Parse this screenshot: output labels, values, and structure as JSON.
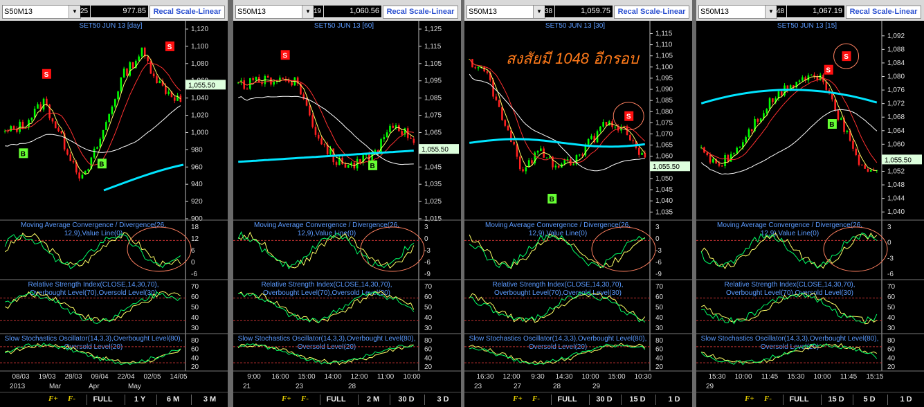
{
  "panels": [
    {
      "symbol": "S50M13",
      "count": "25",
      "price": "977.85",
      "recal": "Recal Scale-Linear",
      "chart_title": "SET50 JUN 13",
      "interval": "[day]",
      "price_label": "1,055.50",
      "yticks": [
        "1,120",
        "1,100",
        "1,080",
        "1,060",
        "1,040",
        "1,020",
        "1,000",
        "980",
        "960",
        "940",
        "920",
        "900"
      ],
      "ymin": 900,
      "ymax": 1120,
      "current_value": 1055.5,
      "xlabels": [
        "08/03",
        "19/03",
        "28/03",
        "09/04",
        "22/04",
        "02/05",
        "14/05"
      ],
      "xlabels2": [
        "2013",
        "Mar",
        "Apr",
        "May"
      ],
      "signals": [
        {
          "t": "S",
          "x": 0.24,
          "yv": 1068
        },
        {
          "t": "S",
          "x": 0.93,
          "yv": 1100
        },
        {
          "t": "B",
          "x": 0.11,
          "yv": 976
        },
        {
          "t": "B",
          "x": 0.55,
          "yv": 964
        }
      ],
      "macd_ticks": [
        "18",
        "12",
        "6",
        "0",
        "-6"
      ],
      "buttons": [
        "FULL",
        "1 Y",
        "6 M",
        "3 M"
      ],
      "circle_macd": true,
      "annotation": ""
    },
    {
      "symbol": "S50M13",
      "count": "19",
      "price": "1,060.56",
      "recal": "Recal Scale-Linear",
      "chart_title": "SET50 JUN 13",
      "interval": "[60]",
      "price_label": "1,055.50",
      "yticks": [
        "1,125",
        "1,115",
        "1,105",
        "1,095",
        "1,085",
        "1,075",
        "1,065",
        "1,055",
        "1,045",
        "1,035",
        "1,025",
        "1,015"
      ],
      "ymin": 1015,
      "ymax": 1125,
      "current_value": 1055.5,
      "xlabels": [
        "9:00",
        "16:00",
        "15:00",
        "14:00",
        "12:00",
        "11:00",
        "10:00"
      ],
      "xlabels2": [
        "21",
        "23",
        "28"
      ],
      "signals": [
        {
          "t": "S",
          "x": 0.27,
          "yv": 1110
        },
        {
          "t": "B",
          "x": 0.76,
          "yv": 1046
        }
      ],
      "macd_ticks": [
        "3",
        "0",
        "-3",
        "-6",
        "-9"
      ],
      "buttons": [
        "FULL",
        "2 M",
        "30 D",
        "3 D"
      ],
      "circle_macd": true,
      "annotation": ""
    },
    {
      "symbol": "S50M13",
      "count": "38",
      "price": "1,059.75",
      "recal": "Recal Scale-Linear",
      "chart_title": "SET50 JUN 13",
      "interval": "[30]",
      "price_label": "1,055.50",
      "yticks": [
        "1,115",
        "1,110",
        "1,105",
        "1,100",
        "1,095",
        "1,090",
        "1,085",
        "1,080",
        "1,075",
        "1,070",
        "1,065",
        "1,060",
        "1,055",
        "1,050",
        "1,045",
        "1,040",
        "1,035"
      ],
      "ymin": 1032,
      "ymax": 1117,
      "current_value": 1055.5,
      "xlabels": [
        "16:30",
        "12:00",
        "9:30",
        "14:30",
        "10:00",
        "15:00",
        "10:30"
      ],
      "xlabels2": [
        "23",
        "27",
        "28",
        "29"
      ],
      "signals": [
        {
          "t": "S",
          "x": 0.9,
          "yv": 1078
        },
        {
          "t": "B",
          "x": 0.47,
          "yv": 1041
        }
      ],
      "macd_ticks": [
        "3",
        "0",
        "-3",
        "-6",
        "-9"
      ],
      "buttons": [
        "FULL",
        "30 D",
        "15 D",
        "1 D"
      ],
      "circle_macd": true,
      "annotation": "สงสัยมี 1048 อีกรอบ"
    },
    {
      "symbol": "S50M13",
      "count": "48",
      "price": "1,067.19",
      "recal": "Recal Scale-Linear",
      "chart_title": "SET50 JUN 13",
      "interval": "[15]",
      "price_label": "1,055.50",
      "yticks": [
        "1,092",
        "1,088",
        "1,084",
        "1,080",
        "1,076",
        "1,072",
        "1,068",
        "1,064",
        "1,060",
        "1,056",
        "1,052",
        "1,048",
        "1,044",
        "1,040"
      ],
      "ymin": 1038,
      "ymax": 1094,
      "current_value": 1055.5,
      "xlabels": [
        "15:30",
        "10:00",
        "11:45",
        "15:30",
        "10:00",
        "11:45",
        "15:15"
      ],
      "xlabels2": [
        "29"
      ],
      "signals": [
        {
          "t": "S",
          "x": 0.72,
          "yv": 1082
        },
        {
          "t": "S",
          "x": 0.82,
          "yv": 1086
        },
        {
          "t": "B",
          "x": 0.74,
          "yv": 1066
        }
      ],
      "macd_ticks": [
        "3",
        "0",
        "-3",
        "-6"
      ],
      "buttons": [
        "FULL",
        "15 D",
        "5 D",
        "1 D"
      ],
      "circle_macd": true,
      "annotation": ""
    }
  ],
  "indicators": {
    "macd_label": "Moving Average Convergence / Divergence(26,12,9),Value Line(0)",
    "rsi_label": "Relative Strength Index(CLOSE,14,30,70),Overbought Level(70),Oversold Level(30)",
    "stoch_label": "Slow Stochastics Oscillator(14,3,3),Overbought Level(80),Oversold Level(20)",
    "rsi_ticks": [
      "70",
      "60",
      "50",
      "40",
      "30"
    ],
    "stoch_ticks": [
      "80",
      "60",
      "40",
      "20"
    ]
  },
  "colors": {
    "up": "#00ff00",
    "down": "#ff2020",
    "ma_fast": "#ffff66",
    "ma_slow": "#ff3030",
    "ma_long": "#ffffff",
    "ma_cyan": "#00e5ff",
    "sell": "#ff1010",
    "buy": "#66ff33",
    "title": "#5b9bff",
    "annotation": "#ff7a1a",
    "circle": "#ff8060"
  }
}
